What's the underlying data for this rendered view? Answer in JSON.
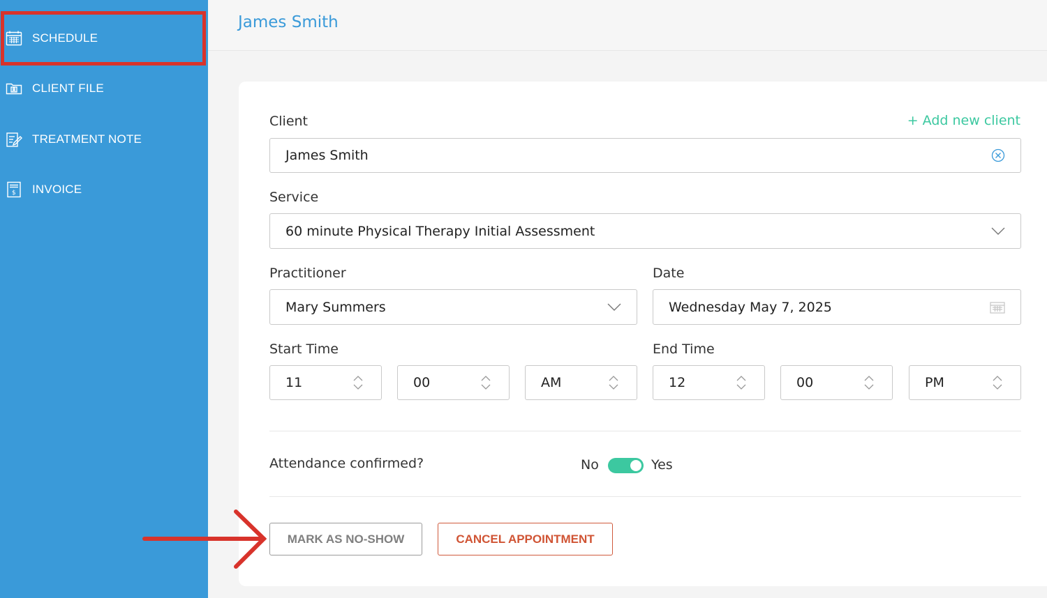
{
  "sidebar": {
    "items": [
      {
        "label": "SCHEDULE",
        "icon": "calendar-icon"
      },
      {
        "label": "CLIENT FILE",
        "icon": "client-folder-icon"
      },
      {
        "label": "TREATMENT NOTE",
        "icon": "edit-note-icon"
      },
      {
        "label": "INVOICE",
        "icon": "invoice-icon"
      }
    ],
    "selected": "SCHEDULE"
  },
  "header": {
    "title": "James Smith"
  },
  "form": {
    "client": {
      "label": "Client",
      "value": "James Smith",
      "add_link": "+ Add new client",
      "clear_icon": "clear-circle-icon"
    },
    "service": {
      "label": "Service",
      "value": "60 minute Physical Therapy Initial Assessment"
    },
    "practitioner": {
      "label": "Practitioner",
      "value": "Mary Summers"
    },
    "date": {
      "label": "Date",
      "value": "Wednesday May 7, 2025"
    },
    "start_time": {
      "label": "Start Time",
      "hour": "11",
      "minute": "00",
      "period": "AM"
    },
    "end_time": {
      "label": "End Time",
      "hour": "12",
      "minute": "00",
      "period": "PM"
    },
    "attendance": {
      "label": "Attendance confirmed?",
      "no": "No",
      "yes": "Yes",
      "confirmed": true
    }
  },
  "actions": {
    "no_show": "MARK AS NO-SHOW",
    "cancel": "CANCEL APPOINTMENT"
  },
  "colors": {
    "sidebar": "#3a9ad9",
    "accent": "#3a9ad9",
    "green": "#3cc8a0",
    "danger": "#d05434",
    "annotation": "#d8332b"
  }
}
